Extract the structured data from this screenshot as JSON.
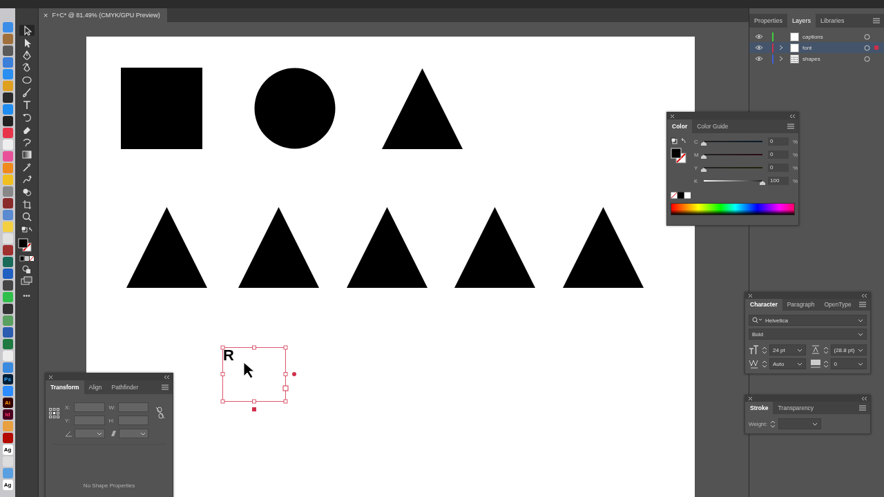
{
  "dock": [
    {
      "color": "#3b8ee8"
    },
    {
      "color": "#a0703c"
    },
    {
      "color": "#5a5a5a"
    },
    {
      "color": "#3b7fd8"
    },
    {
      "color": "#2a8ff0"
    },
    {
      "color": "#dfa020"
    },
    {
      "color": "#2b2b2b"
    },
    {
      "color": "#1e8cf0"
    },
    {
      "color": "#222222"
    },
    {
      "color": "#e8344a"
    },
    {
      "color": "#eeeeee"
    },
    {
      "color": "#e9509a"
    },
    {
      "color": "#f08a1c"
    },
    {
      "color": "#f0c020"
    },
    {
      "color": "#888888"
    },
    {
      "color": "#8a2a2a"
    },
    {
      "color": "#5a8ad0"
    },
    {
      "color": "#f4d040"
    },
    {
      "color": "#e0e0e0"
    },
    {
      "color": "#a03030"
    },
    {
      "color": "#1a6a5a"
    },
    {
      "color": "#2060c0"
    },
    {
      "color": "#444444"
    },
    {
      "color": "#2fbf4a"
    },
    {
      "color": "#333333"
    },
    {
      "color": "#5aa060"
    },
    {
      "color": "#2b5cb0"
    },
    {
      "color": "#1e7a40"
    },
    {
      "color": "#ececec"
    },
    {
      "color": "#3a8ae0"
    },
    {
      "color": "#001e36",
      "label": "Ps"
    },
    {
      "color": "#2d8cff"
    },
    {
      "color": "#330000",
      "label": "Ai"
    },
    {
      "color": "#49021f",
      "label": "Id"
    },
    {
      "color": "#e8a040"
    },
    {
      "color": "#b30b00"
    },
    {
      "color": "#ffffff",
      "label": "Ag"
    },
    {
      "color": "#dddddd"
    },
    {
      "color": "#5aa0e0"
    },
    {
      "color": "#ffffff",
      "label": "Ag"
    }
  ],
  "document_tab": {
    "close": "×",
    "title": "F+C* @ 81.49% (CMYK/GPU Preview)"
  },
  "tools": [
    {
      "kind": "selection",
      "selected": true
    },
    {
      "kind": "direct",
      "selected": false
    },
    {
      "kind": "pen",
      "selected": false
    },
    {
      "kind": "curvature",
      "selected": false
    },
    {
      "kind": "ellipse",
      "selected": false
    },
    {
      "kind": "brush",
      "selected": false
    },
    {
      "kind": "type",
      "selected": false
    },
    {
      "kind": "rotate",
      "selected": false
    },
    {
      "kind": "eraser",
      "selected": false
    },
    {
      "kind": "shaper",
      "selected": false
    },
    {
      "kind": "gradient",
      "selected": false
    },
    {
      "kind": "eyedropper",
      "selected": false
    },
    {
      "kind": "puppet",
      "selected": false
    },
    {
      "kind": "builder",
      "selected": false
    },
    {
      "kind": "artboard",
      "selected": false
    },
    {
      "kind": "zoom",
      "selected": false
    }
  ],
  "tools_more": "•••",
  "artboard": {
    "text_frame": "R"
  },
  "layers_panel": {
    "tabs": [
      {
        "label": "Properties",
        "selected": false
      },
      {
        "label": "Layers",
        "selected": true
      },
      {
        "label": "Libraries",
        "selected": false
      }
    ],
    "layers": [
      {
        "name": "captions",
        "color": "#3fcf3f",
        "expandable": false,
        "selected": false
      },
      {
        "name": "font",
        "color": "#d0304a",
        "expandable": true,
        "selected": true
      },
      {
        "name": "shapes",
        "color": "#3f5fdf",
        "expandable": true,
        "selected": false
      }
    ]
  },
  "color_panel": {
    "tabs": [
      {
        "label": "Color",
        "selected": true
      },
      {
        "label": "Color Guide",
        "selected": false
      }
    ],
    "channels": [
      {
        "label": "C",
        "level": 0,
        "value": "0",
        "unit": "%"
      },
      {
        "label": "M",
        "level": 0,
        "value": "0",
        "unit": "%"
      },
      {
        "label": "Y",
        "level": 0,
        "value": "0",
        "unit": "%"
      },
      {
        "label": "K",
        "level": 1,
        "value": "100",
        "unit": "%"
      }
    ]
  },
  "character_panel": {
    "tabs": [
      {
        "label": "Character",
        "selected": true
      },
      {
        "label": "Paragraph",
        "selected": false
      },
      {
        "label": "OpenType",
        "selected": false
      }
    ],
    "font": "Helvetica",
    "style": "Bold",
    "size": "24 pt",
    "leading": "(28.8 pt)",
    "kerning": "Auto",
    "tracking": "0"
  },
  "stroke_panel": {
    "tabs": [
      {
        "label": "Stroke",
        "selected": true
      },
      {
        "label": "Transparency",
        "selected": false
      }
    ],
    "weight_label": "Weight:"
  },
  "transform_panel": {
    "tabs": [
      {
        "label": "Transform",
        "selected": true
      },
      {
        "label": "Align",
        "selected": false
      },
      {
        "label": "Pathfinder",
        "selected": false
      }
    ],
    "fields": [
      {
        "label": "X:"
      },
      {
        "label": "W:"
      },
      {
        "label": "Y:"
      },
      {
        "label": "H:"
      }
    ],
    "disabled": true,
    "message": "No Shape Properties"
  }
}
